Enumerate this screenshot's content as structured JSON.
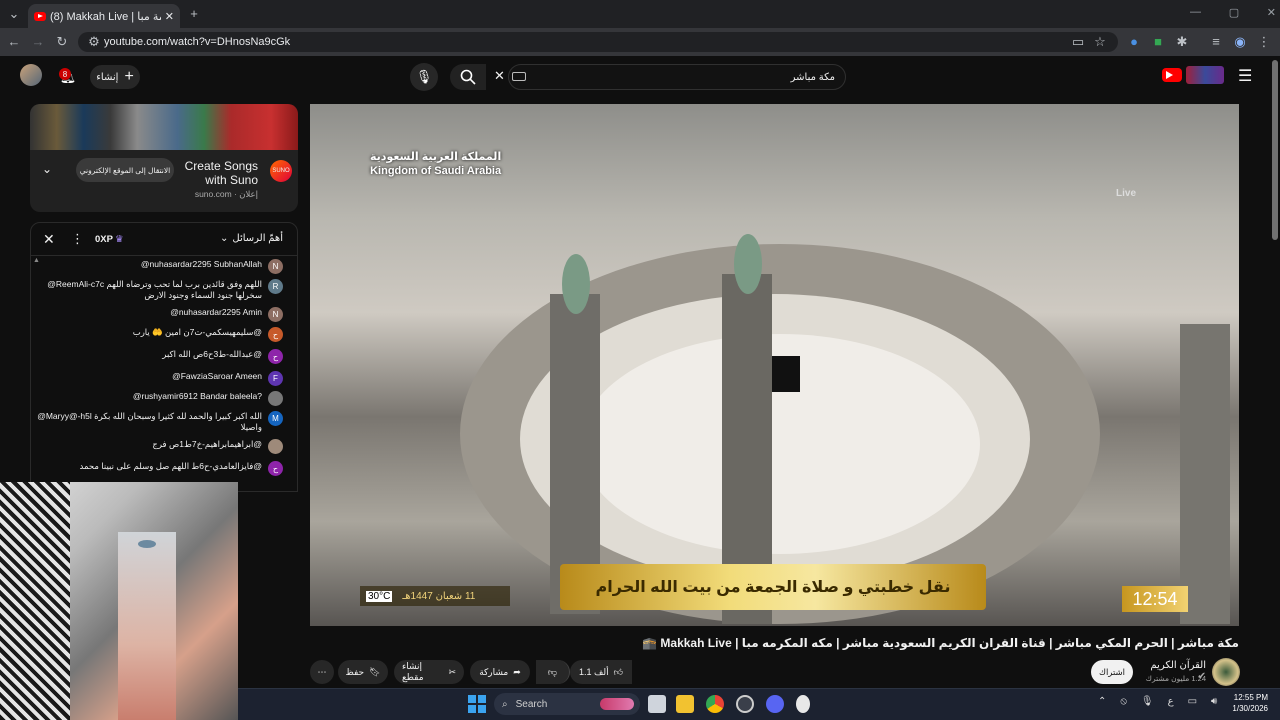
{
  "browser": {
    "tab_title": "(8) Makkah Live | مكة المكرمة مبا",
    "url": "youtube.com/watch?v=DHnosNa9cGk"
  },
  "header": {
    "search_query": "مكة مباشر",
    "notification_count": "8",
    "create_label": "إنشاء"
  },
  "ad": {
    "title_line1": "Create Songs",
    "title_line2": "with Suno",
    "sponsor": "إعلان · suno.com",
    "cta": "الانتقال إلى الموقع الإلكتروني",
    "logo_text": "SUNO"
  },
  "chat": {
    "header": "أهمّ الرسائل",
    "points": "0XP",
    "messages": [
      {
        "avatar": "N",
        "color": "#8d6e63",
        "text": "@nuhasardar2295 SubhanAllah"
      },
      {
        "avatar": "R",
        "color": "#5f7a8a",
        "text": "@ReemAli-c7c اللهم وفق قائدين برب لما تحب وترضاه اللهم سخرلها جنود السماء وجنود الارض"
      },
      {
        "avatar": "N",
        "color": "#8d6e63",
        "text": "@nuhasardar2295 Amin"
      },
      {
        "avatar": "ح",
        "color": "#c75a2a",
        "text": "@سليمهيسكمي-ت7ن امين 🤲 يارب"
      },
      {
        "avatar": "ح",
        "color": "#8e24aa",
        "text": "@عبدالله-ط3ح6ص الله اكبر"
      },
      {
        "avatar": "F",
        "color": "#5e35b1",
        "text": "@FawziaSaroar Ameen"
      },
      {
        "avatar": "",
        "color": "#777",
        "text": "@rushyamir6912 Bandar baleela?"
      },
      {
        "avatar": "M",
        "color": "#1565c0",
        "text": "@Maryy@-h5l الله اكبر كبيرا والحمد لله كثيرا وسبحان الله بكرة واصيلا"
      },
      {
        "avatar": "",
        "color": "#9e8a7a",
        "text": "@ابراهيمابراهيم-خ7ط1ص فرج"
      },
      {
        "avatar": "ح",
        "color": "#8e24aa",
        "text": "@فايزالعامدي-ح6ط اللهم صل وسلم على نبينا محمد"
      }
    ]
  },
  "video": {
    "banner_text": "نقل خطبتي و صلاة الجمعة من بيت الله الحرام",
    "clock": "12:54",
    "date": "11 شعبان 1447هـ",
    "temperature": "30°C",
    "kingdom_ar": "المملكة العربية السعودية",
    "kingdom_en": "Kingdom of Saudi Arabia",
    "watermark": "Live"
  },
  "meta": {
    "title": "مكة مباشر | الحرم المكي مباشر | قناة القران الكريم السعودية مباشر | مكه المكرمه مبا | Makkah Live 🕋",
    "channel": "القرآن الكريم",
    "subscribers": "1.24 مليون مشترك",
    "subscribe": "اشتراك",
    "likes": "1.1 ألف",
    "share": "مشاركة",
    "clip": "إنشاء مقطع",
    "save": "حفظ"
  },
  "taskbar": {
    "search": "Search",
    "time": "12:55 PM",
    "date": "1/30/2026",
    "lang": "ع"
  }
}
